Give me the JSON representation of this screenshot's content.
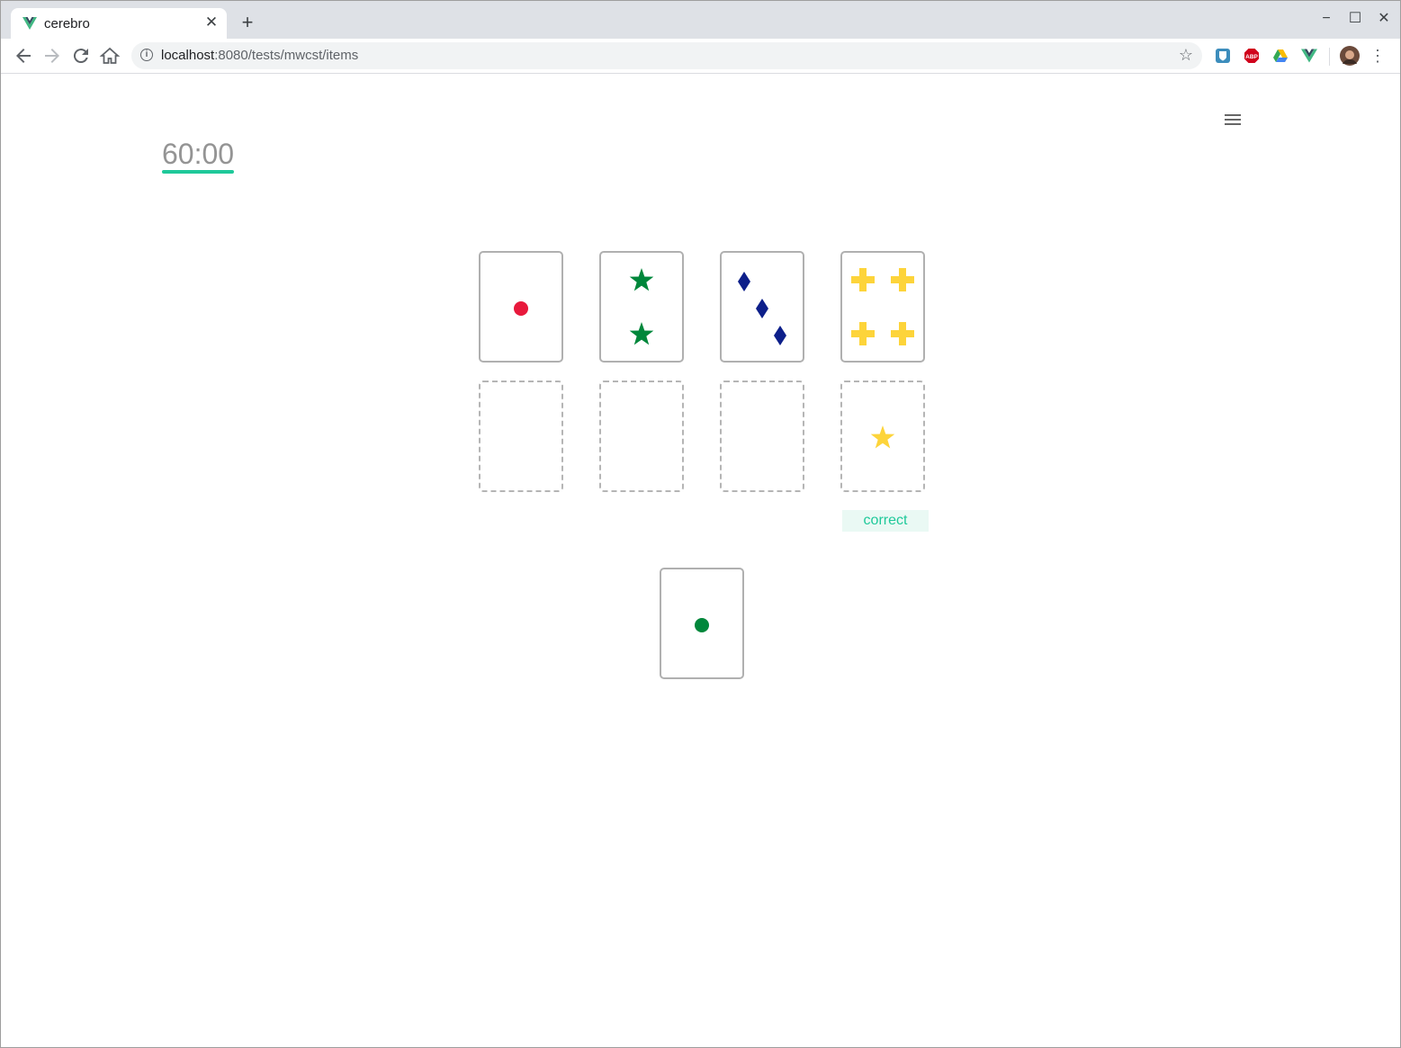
{
  "browser": {
    "tab_title": "cerebro",
    "tab_close": "✕",
    "new_tab": "+",
    "url_host": "localhost",
    "url_rest": ":8080/tests/mwcst/items",
    "controls": {
      "minimize": "−",
      "maximize": "☐",
      "close": "✕"
    }
  },
  "page": {
    "timer": "60:00",
    "feedback_label": "correct",
    "colors": {
      "accent": "#1fc99a",
      "red": "#e8193c",
      "green": "#00873b",
      "blue": "#0d1f8a",
      "yellow": "#fdd43a"
    }
  },
  "stimulus_cards": [
    {
      "shape": "circle",
      "color": "red",
      "count": 1
    },
    {
      "shape": "star",
      "color": "green",
      "count": 2
    },
    {
      "shape": "diamond",
      "color": "blue",
      "count": 3
    },
    {
      "shape": "cross",
      "color": "yellow",
      "count": 4
    }
  ],
  "pile_slots": [
    {
      "state": "empty"
    },
    {
      "state": "empty"
    },
    {
      "state": "empty"
    },
    {
      "state": "filled",
      "shape": "star",
      "color": "yellow",
      "count": 1
    }
  ],
  "response_card": {
    "shape": "circle",
    "color": "green",
    "count": 1
  }
}
